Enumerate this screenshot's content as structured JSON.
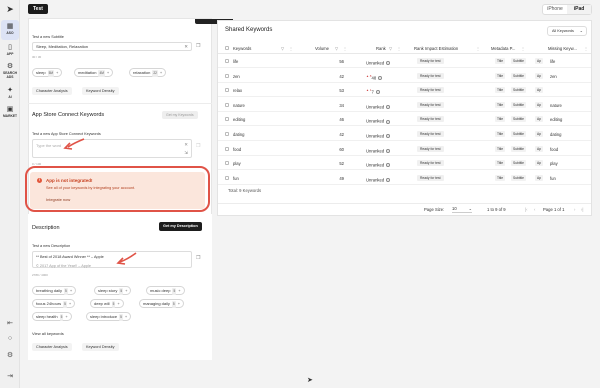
{
  "topbar": {
    "test_label": "Test",
    "device_options": [
      "iPhone",
      "iPad"
    ],
    "device_selected": "iPad"
  },
  "rail": {
    "items": [
      {
        "label": "ASO",
        "icon": "app-grid-icon"
      },
      {
        "label": "APP",
        "icon": "device-icon"
      },
      {
        "label": "SEARCH ADS",
        "icon": "search-ads-icon"
      },
      {
        "label": "AI",
        "icon": "ai-icon"
      },
      {
        "label": "MARKET",
        "icon": "market-icon"
      }
    ]
  },
  "subtitle": {
    "label": "Test a new Subtitle",
    "value": "Sleep, Meditation, Relaxation",
    "meta": "30 / 30",
    "chips": [
      {
        "text": "sleep",
        "count": "5M"
      },
      {
        "text": "meditation",
        "count": "4M"
      },
      {
        "text": "relaxation",
        "count": "22"
      }
    ],
    "btn_character": "Character Analysis",
    "btn_density": "Keyword Density"
  },
  "connect": {
    "title": "App Store Connect Keywords",
    "button": "Get my Keywords",
    "label": "Test a new App Store Connect Keywords",
    "placeholder": "Type the word",
    "meta": "0 / 100"
  },
  "warning": {
    "title": "App is not integrated!",
    "desc": "See all of your keywords by integrating your account.",
    "link": "Integrate now"
  },
  "description": {
    "title": "Description",
    "button": "Get my Description",
    "label": "Test a new Description",
    "line1": "** Best of 2018 Award Winner ** – Apple",
    "line2": "© 2017 App of the Year!! – Apple",
    "meta": "2789 / 4000",
    "chips": [
      {
        "text": "breathing daily",
        "count": "5"
      },
      {
        "text": "sleep story",
        "count": "5"
      },
      {
        "text": "music deep",
        "count": "5"
      },
      {
        "text": "focus 24hours",
        "count": "5"
      },
      {
        "text": "deep will",
        "count": "5"
      },
      {
        "text": "managing daily",
        "count": "5"
      },
      {
        "text": "sleep health",
        "count": "5"
      },
      {
        "text": "sleep introduce",
        "count": "5"
      }
    ],
    "view_all": "View all keywords",
    "btn_character": "Character Analysis",
    "btn_density": "Keyword Density"
  },
  "shared": {
    "title": "Shared Keywords",
    "select": "All Keywords",
    "columns": [
      "Keywords",
      "Volume",
      "Rank",
      "Rank Impact Estimation",
      "Metadata P...",
      "Missing Keyw..."
    ],
    "rows": [
      {
        "keyword": "life",
        "volume": "56",
        "rank": "Unranked",
        "trend": "",
        "impact": "Ready for test",
        "m1": "Title",
        "m2": "Subtitle",
        "m3": "Ap",
        "missing": "life"
      },
      {
        "keyword": "zen",
        "volume": "42",
        "rank": "48",
        "trend": "▲ 8",
        "impact": "Ready for test",
        "m1": "Title",
        "m2": "Subtitle",
        "m3": "Ap",
        "missing": "zen"
      },
      {
        "keyword": "relax",
        "volume": "53",
        "rank": "7",
        "trend": "▲ 1",
        "impact": "Ready for test",
        "m1": "Title",
        "m2": "Subtitle",
        "m3": "Ap",
        "missing": ""
      },
      {
        "keyword": "nature",
        "volume": "34",
        "rank": "Unranked",
        "trend": "",
        "impact": "Ready for test",
        "m1": "Title",
        "m2": "Subtitle",
        "m3": "Ap",
        "missing": "nature"
      },
      {
        "keyword": "editing",
        "volume": "46",
        "rank": "Unranked",
        "trend": "",
        "impact": "Ready for test",
        "m1": "Title",
        "m2": "Subtitle",
        "m3": "Ap",
        "missing": "editing"
      },
      {
        "keyword": "dating",
        "volume": "42",
        "rank": "Unranked",
        "trend": "",
        "impact": "Ready for test",
        "m1": "Title",
        "m2": "Subtitle",
        "m3": "Ap",
        "missing": "dating"
      },
      {
        "keyword": "food",
        "volume": "60",
        "rank": "Unranked",
        "trend": "",
        "impact": "Ready for test",
        "m1": "Title",
        "m2": "Subtitle",
        "m3": "Ap",
        "missing": "food"
      },
      {
        "keyword": "play",
        "volume": "52",
        "rank": "Unranked",
        "trend": "",
        "impact": "Ready for test",
        "m1": "Title",
        "m2": "Subtitle",
        "m3": "Ap",
        "missing": "play"
      },
      {
        "keyword": "fun",
        "volume": "49",
        "rank": "Unranked",
        "trend": "",
        "impact": "Ready for test",
        "m1": "Title",
        "m2": "Subtitle",
        "m3": "Ap",
        "missing": "fun"
      }
    ],
    "total_label": "Total: 9 Keywords",
    "page_size_label": "Page Size:",
    "page_size": "10",
    "range": "1 to 9 of 9",
    "page_info": "Page 1 of 1"
  },
  "colors": {
    "accent_dark": "#1b1b1b",
    "warning_bg": "#fbe6dc",
    "annotation_red": "#e05347"
  }
}
